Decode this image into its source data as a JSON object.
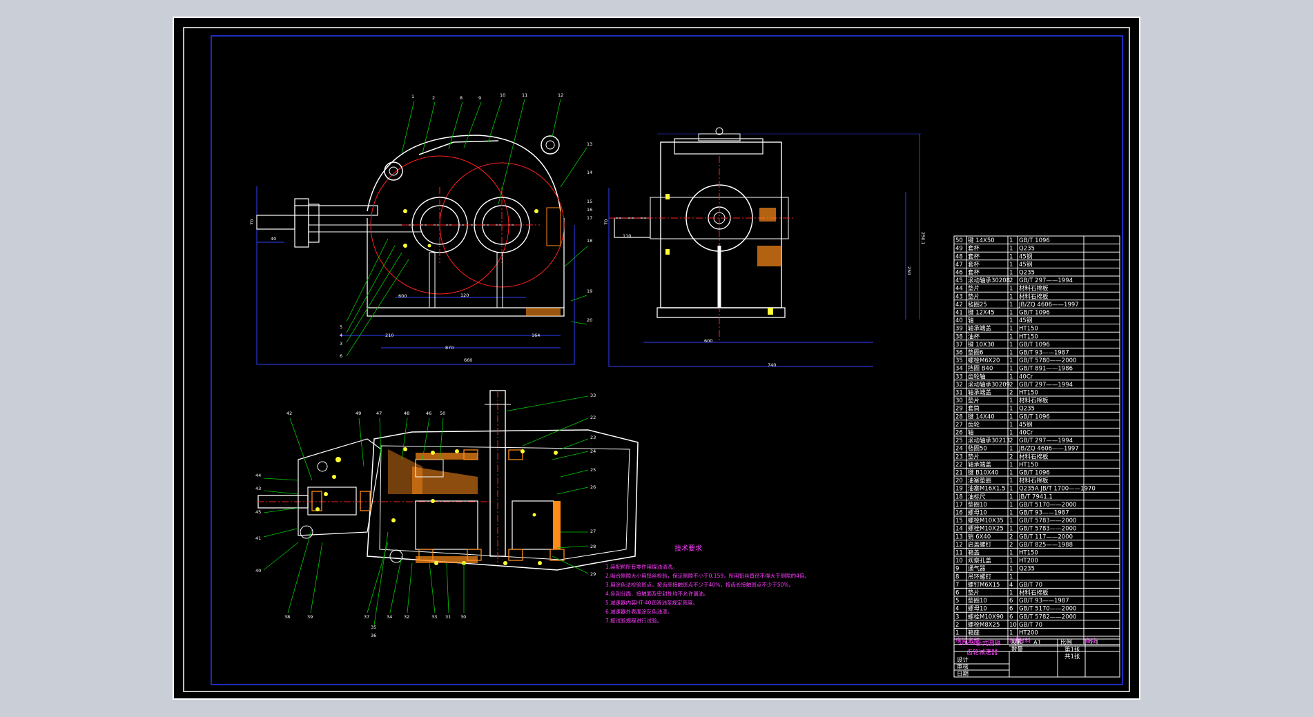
{
  "technical_requirements": {
    "title": "技术要求",
    "lines": [
      "1.装配前所有零件用煤油清洗。",
      "2.啮合侧隙大小用铅丝检验，保证侧隙不小于0.159，所用铅丝直径不得大于侧隙的4倍。",
      "3.用涂色法检验斑点，按齿高接触斑点不少于40%，按齿长接触斑点不少于50%。",
      "4.各剖分面、接触面及密封处均不允许漏油。",
      "5.减速器内装HT-40润滑油至规定高度。",
      "6.减速器外表面涂灰色油漆。",
      "7.按试验规程进行试验。"
    ]
  },
  "title_block": {
    "name_line1": "10kW卧式圆锥",
    "name_line2": "齿轮减速器",
    "scale_label": "比例",
    "scale_value": "1:1",
    "material_label": "材料",
    "material_value": "A1",
    "qty_label": "数量",
    "sheet_label": "第1张",
    "total_label": "共1张",
    "design_label": "设计",
    "check_label": "审核",
    "approve_label": "日期"
  },
  "bom": {
    "header": [
      "序号",
      "名称",
      "数量",
      "材料",
      "备注"
    ],
    "rows": [
      [
        "50",
        "键 14X50",
        "1",
        "GB/T 1096",
        ""
      ],
      [
        "49",
        "套杯",
        "1",
        "Q235",
        ""
      ],
      [
        "48",
        "套杯",
        "1",
        "45钢",
        ""
      ],
      [
        "47",
        "套杯",
        "1",
        "45钢",
        ""
      ],
      [
        "46",
        "套杯",
        "1",
        "Q235",
        ""
      ],
      [
        "45",
        "滚动轴承30208",
        "2",
        "GB/T 297——1994",
        ""
      ],
      [
        "44",
        "垫片",
        "1",
        "材料石棉板",
        ""
      ],
      [
        "43",
        "垫片",
        "1",
        "材料石棉板",
        ""
      ],
      [
        "42",
        "毡圈25",
        "1",
        "JB/ZQ 4606——1997",
        ""
      ],
      [
        "41",
        "键 12X45",
        "1",
        "GB/T 1096",
        ""
      ],
      [
        "40",
        "轴",
        "1",
        "45钢",
        ""
      ],
      [
        "39",
        "轴承端盖",
        "1",
        "HT150",
        ""
      ],
      [
        "38",
        "油杯",
        "1",
        "HT150",
        ""
      ],
      [
        "37",
        "键 10X30",
        "1",
        "GB/T 1096",
        ""
      ],
      [
        "36",
        "垫圈6",
        "1",
        "GB/T 93——1987",
        ""
      ],
      [
        "35",
        "螺栓M6X20",
        "1",
        "GB/T 5780——2000",
        ""
      ],
      [
        "34",
        "挡圈 B40",
        "1",
        "GB/T 891——1986",
        ""
      ],
      [
        "33",
        "齿轮轴",
        "1",
        "40Cr",
        ""
      ],
      [
        "32",
        "滚动轴承30209",
        "2",
        "GB/T 297——1994",
        ""
      ],
      [
        "31",
        "轴承端盖",
        "2",
        "HT150",
        ""
      ],
      [
        "30",
        "垫片",
        "1",
        "材料石棉板",
        ""
      ],
      [
        "29",
        "套筒",
        "1",
        "Q235",
        ""
      ],
      [
        "28",
        "键 14X40",
        "1",
        "GB/T 1096",
        ""
      ],
      [
        "27",
        "齿轮",
        "1",
        "45钢",
        ""
      ],
      [
        "26",
        "轴",
        "1",
        "40Cr",
        ""
      ],
      [
        "25",
        "滚动轴承30213",
        "2",
        "GB/T 297——1994",
        ""
      ],
      [
        "24",
        "毡圈50",
        "1",
        "JB/ZQ 4606——1997",
        ""
      ],
      [
        "23",
        "垫片",
        "2",
        "材料石棉板",
        ""
      ],
      [
        "22",
        "轴承端盖",
        "1",
        "HT150",
        ""
      ],
      [
        "21",
        "键 B10X40",
        "1",
        "GB/T 1096",
        ""
      ],
      [
        "20",
        "油塞垫圈",
        "1",
        "材料石棉板",
        ""
      ],
      [
        "19",
        "油塞M16X1.5",
        "1",
        "Q235A JB/T 1700——1970",
        ""
      ],
      [
        "18",
        "油标尺",
        "1",
        "JB/T 7941.1",
        ""
      ],
      [
        "17",
        "垫圈10",
        "1",
        "GB/T 5170——2000",
        ""
      ],
      [
        "16",
        "螺母10",
        "1",
        "GB/T 93——1987",
        ""
      ],
      [
        "15",
        "螺栓M10X35",
        "1",
        "GB/T 5783——2000",
        ""
      ],
      [
        "14",
        "螺栓M10X25",
        "1",
        "GB/T 5783——2000",
        ""
      ],
      [
        "13",
        "销 6X40",
        "2",
        "GB/T 117——2000",
        ""
      ],
      [
        "12",
        "启盖螺钉",
        "2",
        "GB/T 825——1988",
        ""
      ],
      [
        "11",
        "箱盖",
        "1",
        "HT150",
        ""
      ],
      [
        "10",
        "观察孔盖",
        "1",
        "HT200",
        ""
      ],
      [
        "9",
        "通气器",
        "1",
        "Q235",
        ""
      ],
      [
        "8",
        "吊环螺钉",
        "1",
        "",
        ""
      ],
      [
        "7",
        "螺钉M6X15",
        "4",
        "GB/T 70",
        ""
      ],
      [
        "6",
        "垫片",
        "1",
        "材料石棉板",
        ""
      ],
      [
        "5",
        "垫圈10",
        "6",
        "GB/T 93——1987",
        ""
      ],
      [
        "4",
        "螺母10",
        "6",
        "GB/T 5170——2000",
        ""
      ],
      [
        "3",
        "螺栓M10X90",
        "6",
        "GB/T 5782——2000",
        ""
      ],
      [
        "2",
        "螺栓M8X25",
        "10",
        "GB/T 70",
        ""
      ],
      [
        "1",
        "箱座",
        "1",
        "HT200",
        ""
      ]
    ]
  },
  "colors": {
    "frame": "#2a3bff",
    "outline": "#ffffff",
    "center_line": "#ff2020",
    "leader": "#00cc00",
    "dimension": "#3040ff",
    "technical_text": "#ff3dff",
    "bearing": "#ff8c1a",
    "hatch": "#ff8c1a",
    "bolt": "#ffff33"
  }
}
